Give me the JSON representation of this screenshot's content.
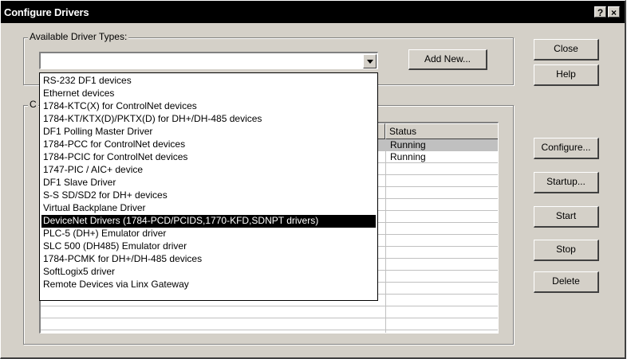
{
  "window": {
    "title": "Configure Drivers",
    "help_glyph": "?",
    "close_glyph": "×"
  },
  "available_group": {
    "label": "Available Driver Types:"
  },
  "combo": {
    "value": "",
    "arrow_icon": "chevron-down-icon"
  },
  "add_new_button": {
    "label": "Add New..."
  },
  "configured_group": {
    "label": "C"
  },
  "dropdown_items": [
    "RS-232 DF1 devices",
    "Ethernet devices",
    "1784-KTC(X) for ControlNet devices",
    "1784-KT/KTX(D)/PKTX(D) for DH+/DH-485 devices",
    "DF1 Polling Master Driver",
    "1784-PCC for ControlNet devices",
    "1784-PCIC for ControlNet devices",
    "1747-PIC / AIC+ device",
    "DF1 Slave Driver",
    "S-S SD/SD2 for DH+ devices",
    "Virtual Backplane Driver",
    "DeviceNet Drivers (1784-PCD/PCIDS,1770-KFD,SDNPT drivers)",
    "PLC-5 (DH+) Emulator driver",
    "SLC 500 (DH485) Emulator driver",
    "1784-PCMK for DH+/DH-485 devices",
    "SoftLogix5 driver",
    "Remote Devices via Linx Gateway"
  ],
  "selected_item_index": 11,
  "table": {
    "status_header": "Status",
    "rows": [
      {
        "status": "Running"
      },
      {
        "status": "Running"
      }
    ]
  },
  "buttons": {
    "close": "Close",
    "help": "Help",
    "configure": "Configure...",
    "startup": "Startup...",
    "start": "Start",
    "stop": "Stop",
    "delete": "Delete"
  }
}
